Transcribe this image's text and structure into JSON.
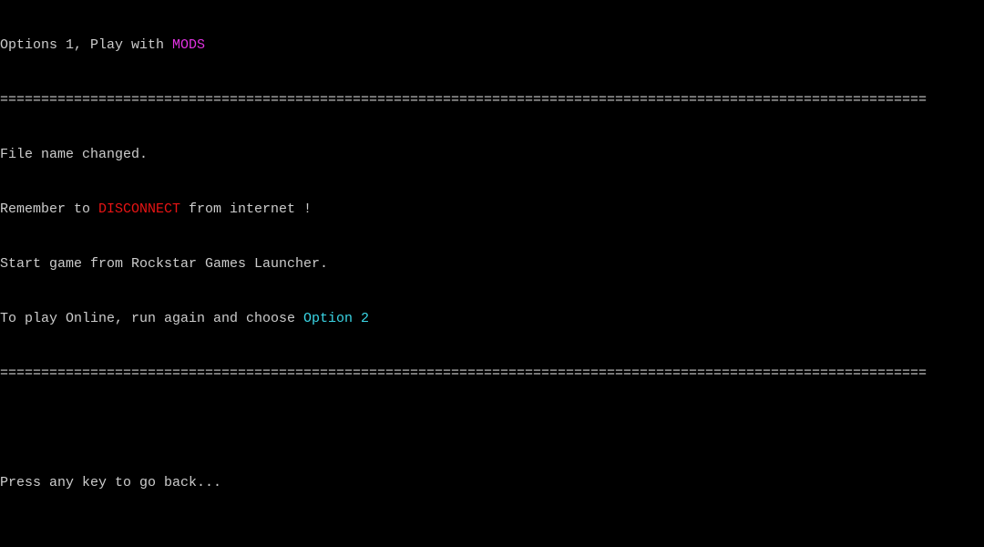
{
  "console": {
    "header": {
      "prefix": "Options 1, Play with ",
      "highlight": "MODS",
      "highlight_color": "#e232e2"
    },
    "separator": "=================================================================================================================",
    "messages": {
      "file_name": "File name changed.",
      "disconnect": {
        "prefix": "Remember to ",
        "highlight": "DISCONNECT",
        "suffix": " from internet !",
        "highlight_color": "#e81414"
      },
      "start_game": "Start game from Rockstar Games Launcher.",
      "online": {
        "prefix": "To play Online, run again and choose ",
        "highlight": "Option 2",
        "highlight_color": "#3ad6e6"
      }
    },
    "prompt": "Press any key to go back...",
    "text_color": "#cccccc",
    "background_color": "#000000"
  }
}
